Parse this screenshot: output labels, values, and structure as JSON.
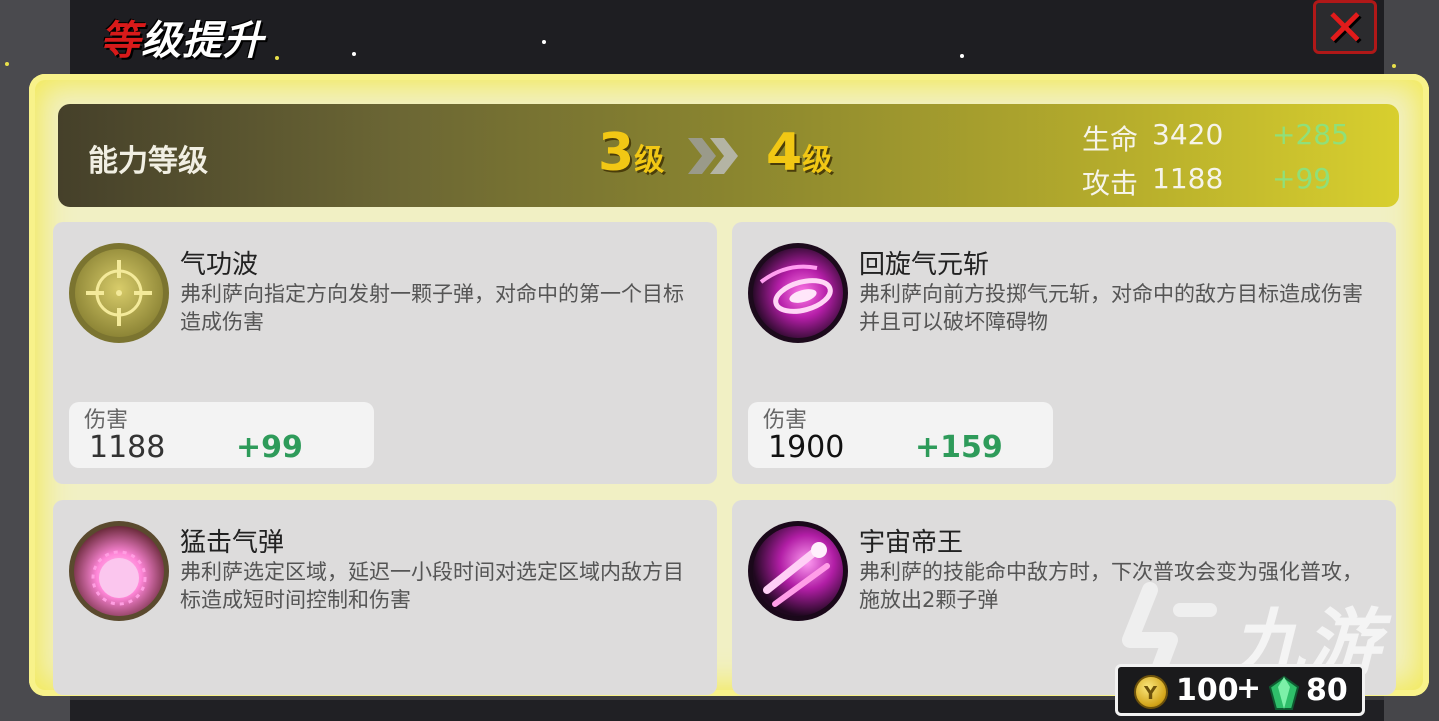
{
  "window": {
    "title_first_char": "等",
    "title_rest": "级提升",
    "close_symbol": "✕"
  },
  "level_bar": {
    "label": "能力等级",
    "from_level": "3",
    "to_level": "4",
    "level_unit": "级",
    "stats": [
      {
        "name": "生命",
        "value": "3420",
        "bonus": "+285"
      },
      {
        "name": "攻击",
        "value": "1188",
        "bonus": "+99"
      }
    ]
  },
  "skills": [
    {
      "name": "气功波",
      "description": "弗利萨向指定方向发射一颗子弹，对命中的第一个目标造成伤害",
      "icon": "crosshair-icon",
      "damage_label": "伤害",
      "damage_value": "1188",
      "damage_bonus": "+99"
    },
    {
      "name": "回旋气元斩",
      "description": "弗利萨向前方投掷气元斩，对命中的敌方目标造成伤害并且可以破坏障碍物",
      "icon": "energy-disc-icon",
      "damage_label": "伤害",
      "damage_value": "1900",
      "damage_bonus": "+159"
    },
    {
      "name": "猛击气弹",
      "description": "弗利萨选定区域，延迟一小段时间对选定区域内敌方目标造成短时间控制和伤害",
      "icon": "energy-ball-icon"
    },
    {
      "name": "宇宙帝王",
      "description": "弗利萨的技能命中敌方时，下次普攻会变为强化普攻，施放出2颗子弹",
      "icon": "energy-bullets-icon"
    }
  ],
  "currency": {
    "coin_amount": "100",
    "plus": "+",
    "gem_amount": "80",
    "coin_symbol": "Y"
  },
  "watermark": {
    "text": "九游"
  },
  "colors": {
    "panel_glow": "#f3ea5a",
    "level_gold": "#f2c814",
    "bonus_green": "#2e9b5a",
    "stat_bonus_green": "#8fe07a",
    "close_red": "#e11b1b"
  }
}
